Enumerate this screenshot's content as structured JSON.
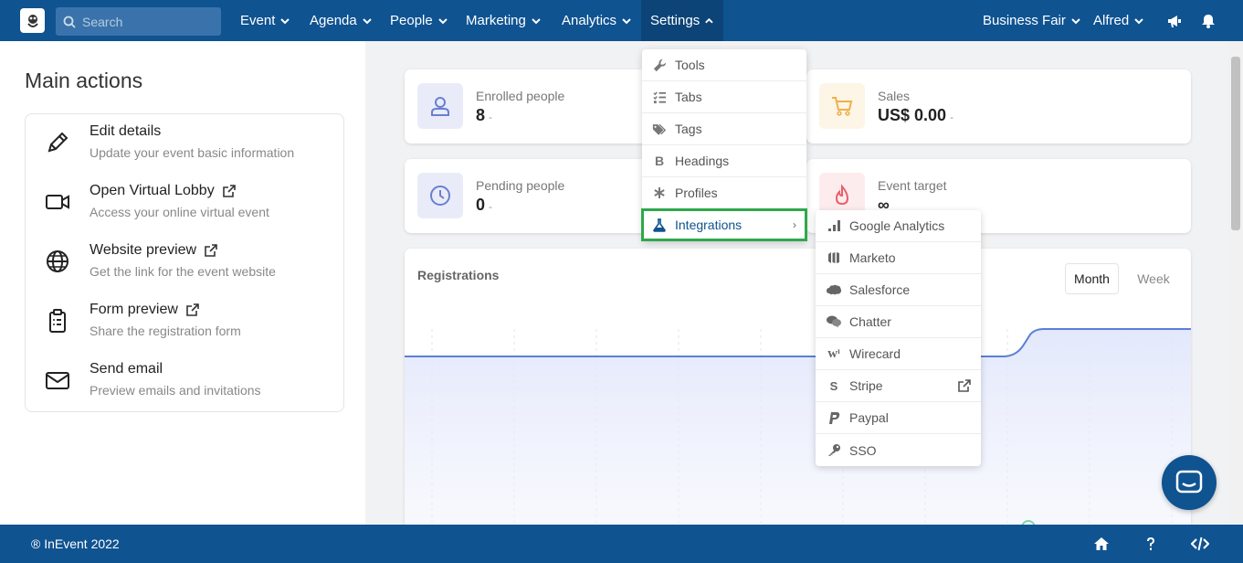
{
  "topbar": {
    "search_placeholder": "Search",
    "nav": [
      {
        "label": "Event"
      },
      {
        "label": "Agenda"
      },
      {
        "label": "People"
      },
      {
        "label": "Marketing"
      },
      {
        "label": "Analytics"
      },
      {
        "label": "Settings"
      }
    ],
    "event_selector": "Business Fair",
    "user": "Alfred"
  },
  "left": {
    "title": "Main actions",
    "actions": [
      {
        "title": "Edit details",
        "subtitle": "Update your event basic information",
        "icon": "pencil-icon"
      },
      {
        "title": "Open Virtual Lobby",
        "subtitle": "Access your online virtual event",
        "icon": "video-camera-icon"
      },
      {
        "title": "Website preview",
        "subtitle": "Get the link for the event website",
        "icon": "globe-icon"
      },
      {
        "title": "Form preview",
        "subtitle": "Share the registration form",
        "icon": "clipboard-icon"
      },
      {
        "title": "Send email",
        "subtitle": "Preview emails and invitations",
        "icon": "envelope-icon"
      }
    ]
  },
  "stats": {
    "enrolled": {
      "label": "Enrolled people",
      "value": "8",
      "dash": "-"
    },
    "sales": {
      "label": "Sales",
      "value": "US$ 0.00",
      "dash": "-"
    },
    "pending": {
      "label": "Pending people",
      "value": "0",
      "dash": "-"
    },
    "target": {
      "label": "Event target",
      "value": "∞"
    }
  },
  "registrations": {
    "title": "Registrations",
    "month_label": "Month",
    "week_label": "Week"
  },
  "settings_menu": [
    {
      "label": "Tools",
      "icon": "wrench-icon"
    },
    {
      "label": "Tabs",
      "icon": "list-check-icon"
    },
    {
      "label": "Tags",
      "icon": "tags-icon"
    },
    {
      "label": "Headings",
      "icon": "bold-icon"
    },
    {
      "label": "Profiles",
      "icon": "asterisk-icon"
    },
    {
      "label": "Integrations",
      "icon": "flask-icon"
    }
  ],
  "integrations_menu": [
    {
      "label": "Google Analytics",
      "icon": "google-analytics-icon"
    },
    {
      "label": "Marketo",
      "icon": "marketo-icon"
    },
    {
      "label": "Salesforce",
      "icon": "salesforce-icon"
    },
    {
      "label": "Chatter",
      "icon": "chatter-icon"
    },
    {
      "label": "Wirecard",
      "icon": "wirecard-icon"
    },
    {
      "label": "Stripe",
      "icon": "stripe-icon"
    },
    {
      "label": "Paypal",
      "icon": "paypal-icon"
    },
    {
      "label": "SSO",
      "icon": "key-icon"
    }
  ],
  "footer": {
    "copyright": "® InEvent 2022"
  },
  "colors": {
    "primary": "#0f5391",
    "highlight_border": "#2ea84a",
    "chart_line": "#5b7fd6"
  }
}
